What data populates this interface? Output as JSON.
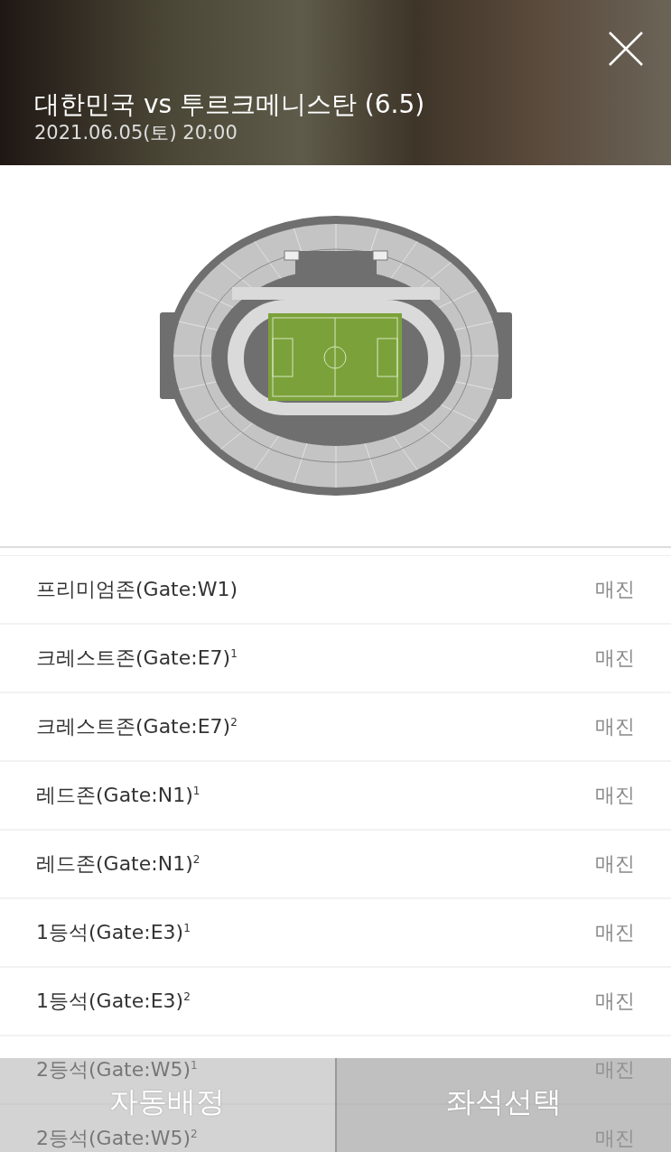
{
  "header": {
    "title": "대한민국 vs 투르크메니스탄 (6.5)",
    "datetime": "2021.06.05(토) 20:00"
  },
  "zones": [
    {
      "name": "프리미엄존(Gate:W1)",
      "status": "매진"
    },
    {
      "name": "크레스트존(Gate:E7)$^{1}$",
      "status": "매진"
    },
    {
      "name": "크레스트존(Gate:E7)$^{2}$",
      "status": "매진"
    },
    {
      "name": "레드존(Gate:N1)$^{1}$",
      "status": "매진"
    },
    {
      "name": "레드존(Gate:N1)$^{2}$",
      "status": "매진"
    },
    {
      "name": "1등석(Gate:E3)$^{1}$",
      "status": "매진"
    },
    {
      "name": "1등석(Gate:E3)$^{2}$",
      "status": "매진"
    },
    {
      "name": "2등석(Gate:W5)$^{1}$",
      "status": "매진"
    },
    {
      "name": "2등석(Gate:W5)$^{2}$",
      "status": "매진"
    }
  ],
  "buttons": [
    {
      "label": "자동배정",
      "kind": "auto"
    },
    {
      "label": "좌석선택",
      "kind": "select"
    }
  ]
}
